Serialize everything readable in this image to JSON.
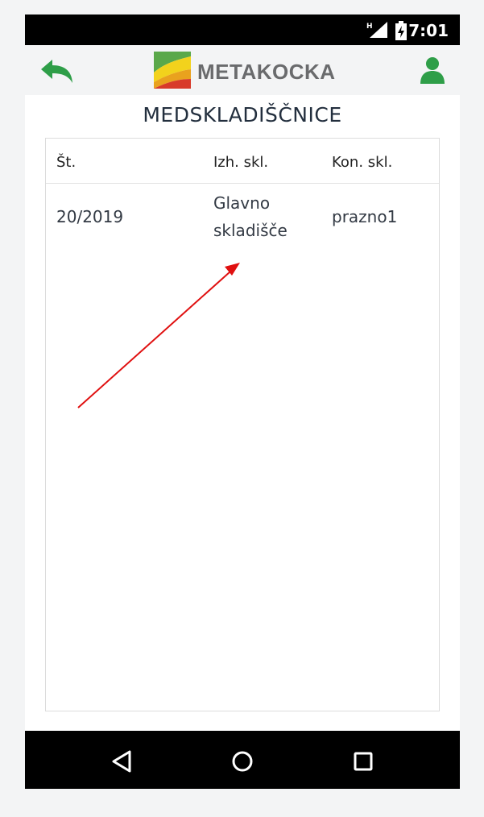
{
  "status_bar": {
    "time": "7:01",
    "network_label": "H"
  },
  "app_bar": {
    "logo_text": "METAKOCKA",
    "back_icon": "back-arrow-icon",
    "user_icon": "user-icon",
    "accent_color": "#2e9e48"
  },
  "page": {
    "title": "MEDSKLADIŠČNICE"
  },
  "table": {
    "headers": [
      "Št.",
      "Izh. skl.",
      "Kon. skl."
    ],
    "rows": [
      {
        "number": "20/2019",
        "source_line1": "Glavno",
        "source_line2": "skladišče",
        "target": "prazno1"
      }
    ]
  },
  "nav_bar": {
    "back": "nav-back-icon",
    "home": "nav-home-icon",
    "recents": "nav-recents-icon"
  }
}
